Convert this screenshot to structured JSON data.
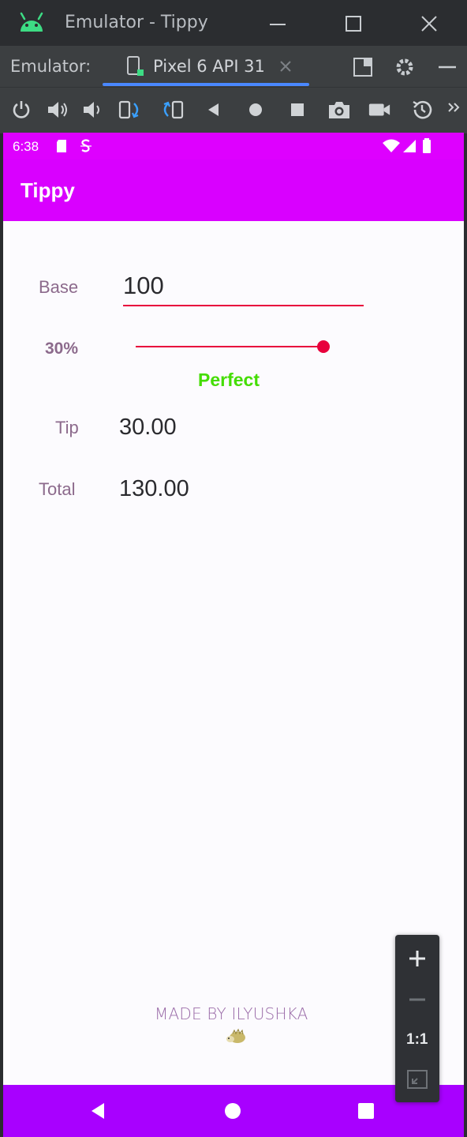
{
  "window": {
    "title": "Emulator - Tippy"
  },
  "tabbar": {
    "label": "Emulator:",
    "device_tab": "Pixel 6 API 31"
  },
  "status": {
    "time": "6:38"
  },
  "app": {
    "title": "Tippy",
    "base_label": "Base",
    "base_value": "100",
    "percent_label": "30%",
    "tip_percent": 30,
    "tip_description": "Perfect",
    "tip_label": "Tip",
    "tip_value": "30.00",
    "total_label": "Total",
    "total_value": "130.00",
    "footer": "MADE BY ILYUSHKA"
  },
  "zoom": {
    "one_to_one": "1:1"
  },
  "colors": {
    "status_bar": "#de00ff",
    "app_bar": "#d900ff",
    "nav_bar": "#a800ff",
    "accent": "#e8003c",
    "perfect_green": "#44dd00"
  }
}
